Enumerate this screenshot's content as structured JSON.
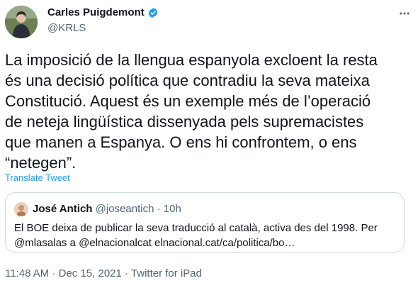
{
  "author": {
    "name": "Carles Puigdemont",
    "handle": "@KRLS",
    "verified_icon": "verified-badge-icon",
    "verified_color": "#1d9bf0"
  },
  "more_icon": "more-options-icon",
  "tweet": {
    "text": "La imposició de la llengua espanyola excloent la resta\nés una decisió política que contradiu la seva mateixa\nConstitució. Aquest és un exemple més de l’operació\nde neteja lingüística dissenyada pels supremacistes\nque manen a Espanya. O ens hi confrontem, o ens\n“netegen”.",
    "translate_label": "Translate Tweet"
  },
  "quoted": {
    "name": "José Antich",
    "handle": "@joseantich",
    "separator": "·",
    "time": "10h",
    "text_line1": "El BOE deixa de publicar la seva traducció al català, activa des del 1998. Per",
    "text_line2": "@mlasalas a @elnacionalcat elnacional.cat/ca/politica/bo…"
  },
  "meta": {
    "time": "11:48 AM",
    "date": "Dec 15, 2021",
    "source": "Twitter for iPad",
    "separator": "·"
  },
  "colors": {
    "text": "#0f1419",
    "muted": "#536471",
    "link": "#1d9bf0",
    "border": "#cfd9de"
  }
}
